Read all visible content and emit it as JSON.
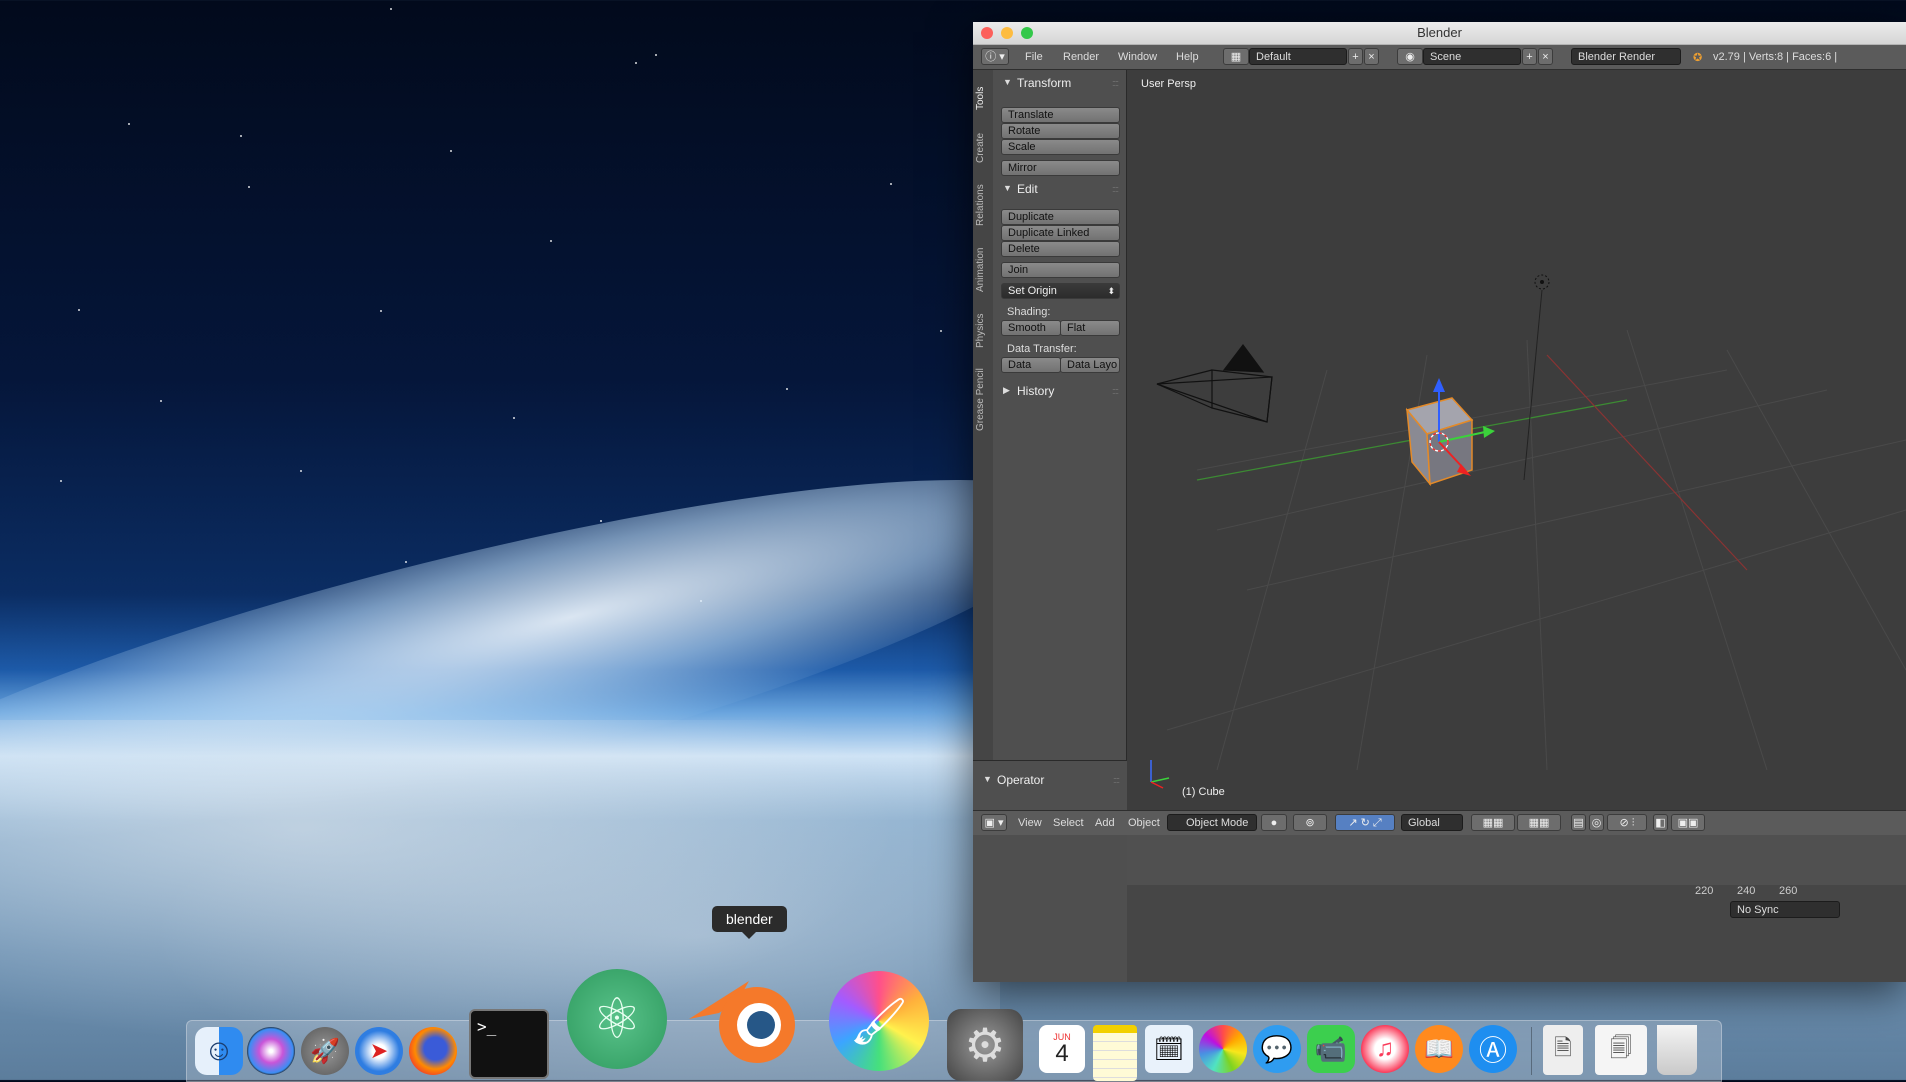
{
  "desktop": {
    "tooltip": "blender"
  },
  "window": {
    "title": "Blender",
    "menu": {
      "items": [
        "File",
        "Render",
        "Window",
        "Help"
      ],
      "layout": "Default",
      "scene": "Scene",
      "engine": "Blender Render",
      "stats": "v2.79 | Verts:8 | Faces:6 |"
    },
    "tabs": [
      "Tools",
      "Create",
      "Relations",
      "Animation",
      "Physics",
      "Grease Pencil"
    ],
    "toolshelf": {
      "transform_title": "Transform",
      "translate": "Translate",
      "rotate": "Rotate",
      "scale": "Scale",
      "mirror": "Mirror",
      "edit_title": "Edit",
      "duplicate": "Duplicate",
      "duplicate_linked": "Duplicate Linked",
      "delete": "Delete",
      "join": "Join",
      "set_origin": "Set Origin",
      "shading_label": "Shading:",
      "smooth": "Smooth",
      "flat": "Flat",
      "data_transfer_label": "Data Transfer:",
      "data": "Data",
      "data_layo": "Data Layo",
      "history_title": "History"
    },
    "operator_title": "Operator",
    "viewport": {
      "persp_label": "User Persp",
      "object_label": "(1) Cube"
    },
    "header": {
      "view": "View",
      "select": "Select",
      "add": "Add",
      "object": "Object",
      "mode": "Object Mode",
      "orientation": "Global"
    },
    "timeline": {
      "ticks": [
        "220",
        "240",
        "260"
      ],
      "sync": "No Sync"
    }
  },
  "dock": {
    "calendar_month": "JUN",
    "calendar_day": "4",
    "terminal_prompt": ">_"
  }
}
